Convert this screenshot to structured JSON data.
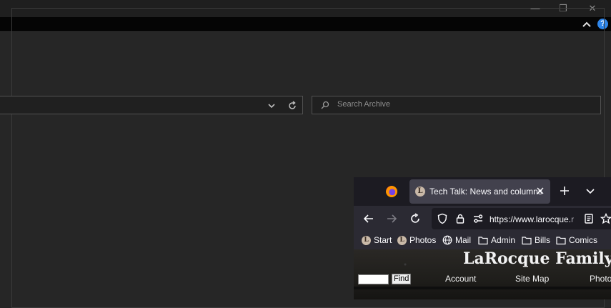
{
  "window": {
    "controls": {
      "minimize": "—",
      "restore": "❐",
      "close": "✕"
    },
    "help_label": "?"
  },
  "archive": {
    "search_placeholder": "Search Archive"
  },
  "firefox": {
    "tab": {
      "title": "Tech Talk: News and columns",
      "favicon_letter": "L"
    },
    "url": {
      "prefix": "https://www.larocque.",
      "rest": "r"
    },
    "bookmarks": [
      {
        "label": "Start",
        "icon": "favicon-L"
      },
      {
        "label": "Photos",
        "icon": "favicon-L"
      },
      {
        "label": "Mail",
        "icon": "globe-icon"
      },
      {
        "label": "Admin",
        "icon": "folder-icon"
      },
      {
        "label": "Bills",
        "icon": "folder-icon"
      },
      {
        "label": "Comics",
        "icon": "folder-icon"
      }
    ],
    "page": {
      "site_title": "LaRocque Family",
      "find_button": "Find",
      "links": [
        "Account",
        "Site Map",
        "Photo"
      ]
    },
    "colors": {
      "tab_bg": "#42414d",
      "toolbar_bg": "#2b2a33",
      "frame_bg": "#1c1b22"
    }
  },
  "colors": {
    "background": "#262626",
    "ribbon": "#050505",
    "help_accent": "#2f86ea"
  }
}
